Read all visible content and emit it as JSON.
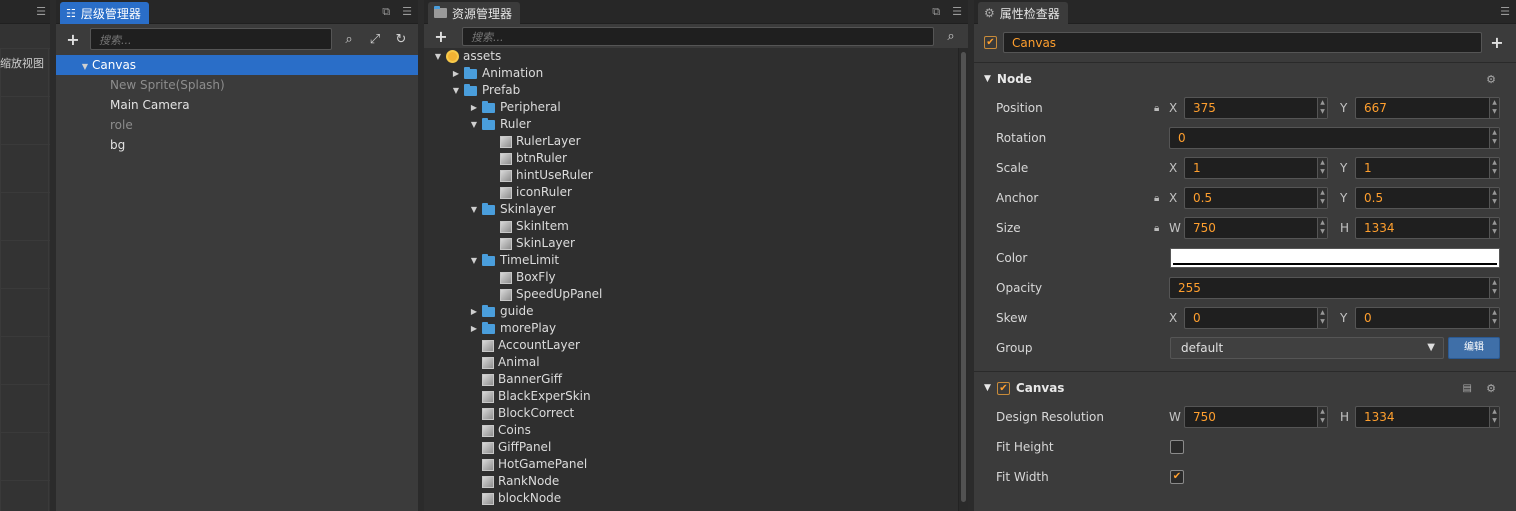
{
  "scene": {
    "zoom_label": "缩放视图"
  },
  "hierarchy": {
    "tab_label": "层级管理器",
    "search_placeholder": "搜索...",
    "nodes": [
      {
        "label": "Canvas",
        "selected": true
      },
      {
        "label": "New Sprite(Splash)",
        "dim": true
      },
      {
        "label": "Main Camera"
      },
      {
        "label": "role",
        "dim": true
      },
      {
        "label": "bg"
      }
    ]
  },
  "assets": {
    "tab_label": "资源管理器",
    "search_placeholder": "搜索...",
    "items": [
      {
        "label": "assets",
        "type": "db",
        "caret": "down"
      },
      {
        "label": "Animation",
        "type": "folder",
        "caret": "right"
      },
      {
        "label": "Prefab",
        "type": "folder",
        "caret": "down"
      },
      {
        "label": "Peripheral",
        "type": "folder",
        "caret": "right"
      },
      {
        "label": "Ruler",
        "type": "folder",
        "caret": "down"
      },
      {
        "label": "RulerLayer",
        "type": "prefab"
      },
      {
        "label": "btnRuler",
        "type": "prefab"
      },
      {
        "label": "hintUseRuler",
        "type": "prefab"
      },
      {
        "label": "iconRuler",
        "type": "prefab"
      },
      {
        "label": "Skinlayer",
        "type": "folder",
        "caret": "down"
      },
      {
        "label": "SkinItem",
        "type": "prefab"
      },
      {
        "label": "SkinLayer",
        "type": "prefab"
      },
      {
        "label": "TimeLimit",
        "type": "folder",
        "caret": "down"
      },
      {
        "label": "BoxFly",
        "type": "prefab"
      },
      {
        "label": "SpeedUpPanel",
        "type": "prefab"
      },
      {
        "label": "guide",
        "type": "folder",
        "caret": "right"
      },
      {
        "label": "morePlay",
        "type": "folder",
        "caret": "right"
      },
      {
        "label": "AccountLayer",
        "type": "prefab"
      },
      {
        "label": "Animal",
        "type": "prefab"
      },
      {
        "label": "BannerGiff",
        "type": "prefab"
      },
      {
        "label": "BlackExperSkin",
        "type": "prefab"
      },
      {
        "label": "BlockCorrect",
        "type": "prefab"
      },
      {
        "label": "Coins",
        "type": "prefab"
      },
      {
        "label": "GiffPanel",
        "type": "prefab"
      },
      {
        "label": "HotGamePanel",
        "type": "prefab"
      },
      {
        "label": "RankNode",
        "type": "prefab"
      },
      {
        "label": "blockNode",
        "type": "prefab"
      }
    ]
  },
  "inspector": {
    "tab_label": "属性检查器",
    "node_name": "Canvas",
    "node_section": "Node",
    "position": {
      "label": "Position",
      "x": "375",
      "y": "667"
    },
    "rotation": {
      "label": "Rotation",
      "value": "0"
    },
    "scale": {
      "label": "Scale",
      "x": "1",
      "y": "1"
    },
    "anchor": {
      "label": "Anchor",
      "x": "0.5",
      "y": "0.5"
    },
    "size": {
      "label": "Size",
      "w": "750",
      "h": "1334"
    },
    "color": {
      "label": "Color",
      "value": "#ffffff"
    },
    "opacity": {
      "label": "Opacity",
      "value": "255"
    },
    "skew": {
      "label": "Skew",
      "x": "0",
      "y": "0"
    },
    "group": {
      "label": "Group",
      "value": "default",
      "edit_label": "编辑"
    },
    "canvas_section": "Canvas",
    "design_resolution": {
      "label": "Design Resolution",
      "w": "750",
      "h": "1334"
    },
    "fit_height": {
      "label": "Fit Height",
      "checked": false
    },
    "fit_width": {
      "label": "Fit Width",
      "checked": true
    },
    "axis": {
      "x": "X",
      "y": "Y",
      "w": "W",
      "h": "H"
    }
  }
}
